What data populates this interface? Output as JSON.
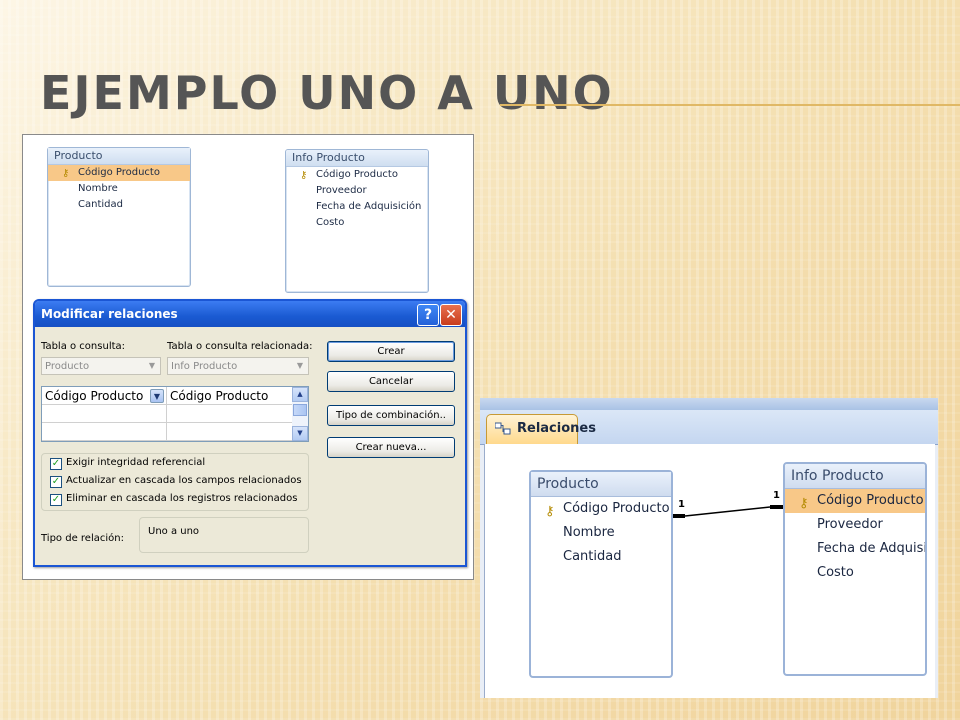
{
  "slide": {
    "title": "EJEMPLO UNO A UNO"
  },
  "shot1": {
    "table_producto": {
      "title": "Producto",
      "fields": [
        "Código Producto",
        "Nombre",
        "Cantidad"
      ]
    },
    "table_info": {
      "title": "Info Producto",
      "fields": [
        "Código Producto",
        "Proveedor",
        "Fecha de Adquisición",
        "Costo"
      ]
    },
    "dialog": {
      "title": "Modificar relaciones",
      "help_glyph": "?",
      "close_glyph": "✕",
      "label_table": "Tabla o consulta:",
      "label_related": "Tabla o consulta relacionada:",
      "combo_table": "Producto",
      "combo_related": "Info Producto",
      "grid": {
        "left": "Código Producto",
        "right": "Código Producto"
      },
      "buttons": {
        "create": "Crear",
        "cancel": "Cancelar",
        "join_type": "Tipo de combinación..",
        "create_new": "Crear nueva..."
      },
      "checks": {
        "integrity": "Exigir integridad referencial",
        "cascade_update": "Actualizar en cascada los campos relacionados",
        "cascade_delete": "Eliminar en cascada los registros relacionados"
      },
      "check_glyph": "✓",
      "rel_type_label": "Tipo de relación:",
      "rel_type_value": "Uno a uno"
    }
  },
  "shot2": {
    "tab_label": "Relaciones",
    "table_producto": {
      "title": "Producto",
      "fields": [
        "Código Producto",
        "Nombre",
        "Cantidad"
      ]
    },
    "table_info": {
      "title": "Info Producto",
      "fields": [
        "Código Producto",
        "Proveedor",
        "Fecha de Adquisición",
        "Costo"
      ]
    },
    "multiplicity_left": "1",
    "multiplicity_right": "1"
  },
  "icons": {
    "key": "key-icon",
    "glyph_key": "🔑",
    "dropdown": "▼",
    "scroll_up": "▲",
    "scroll_down": "▼"
  },
  "colors": {
    "title_bar": "#1a5ad2",
    "selected_field": "#f8c888",
    "slide_rule": "#e0b865"
  }
}
